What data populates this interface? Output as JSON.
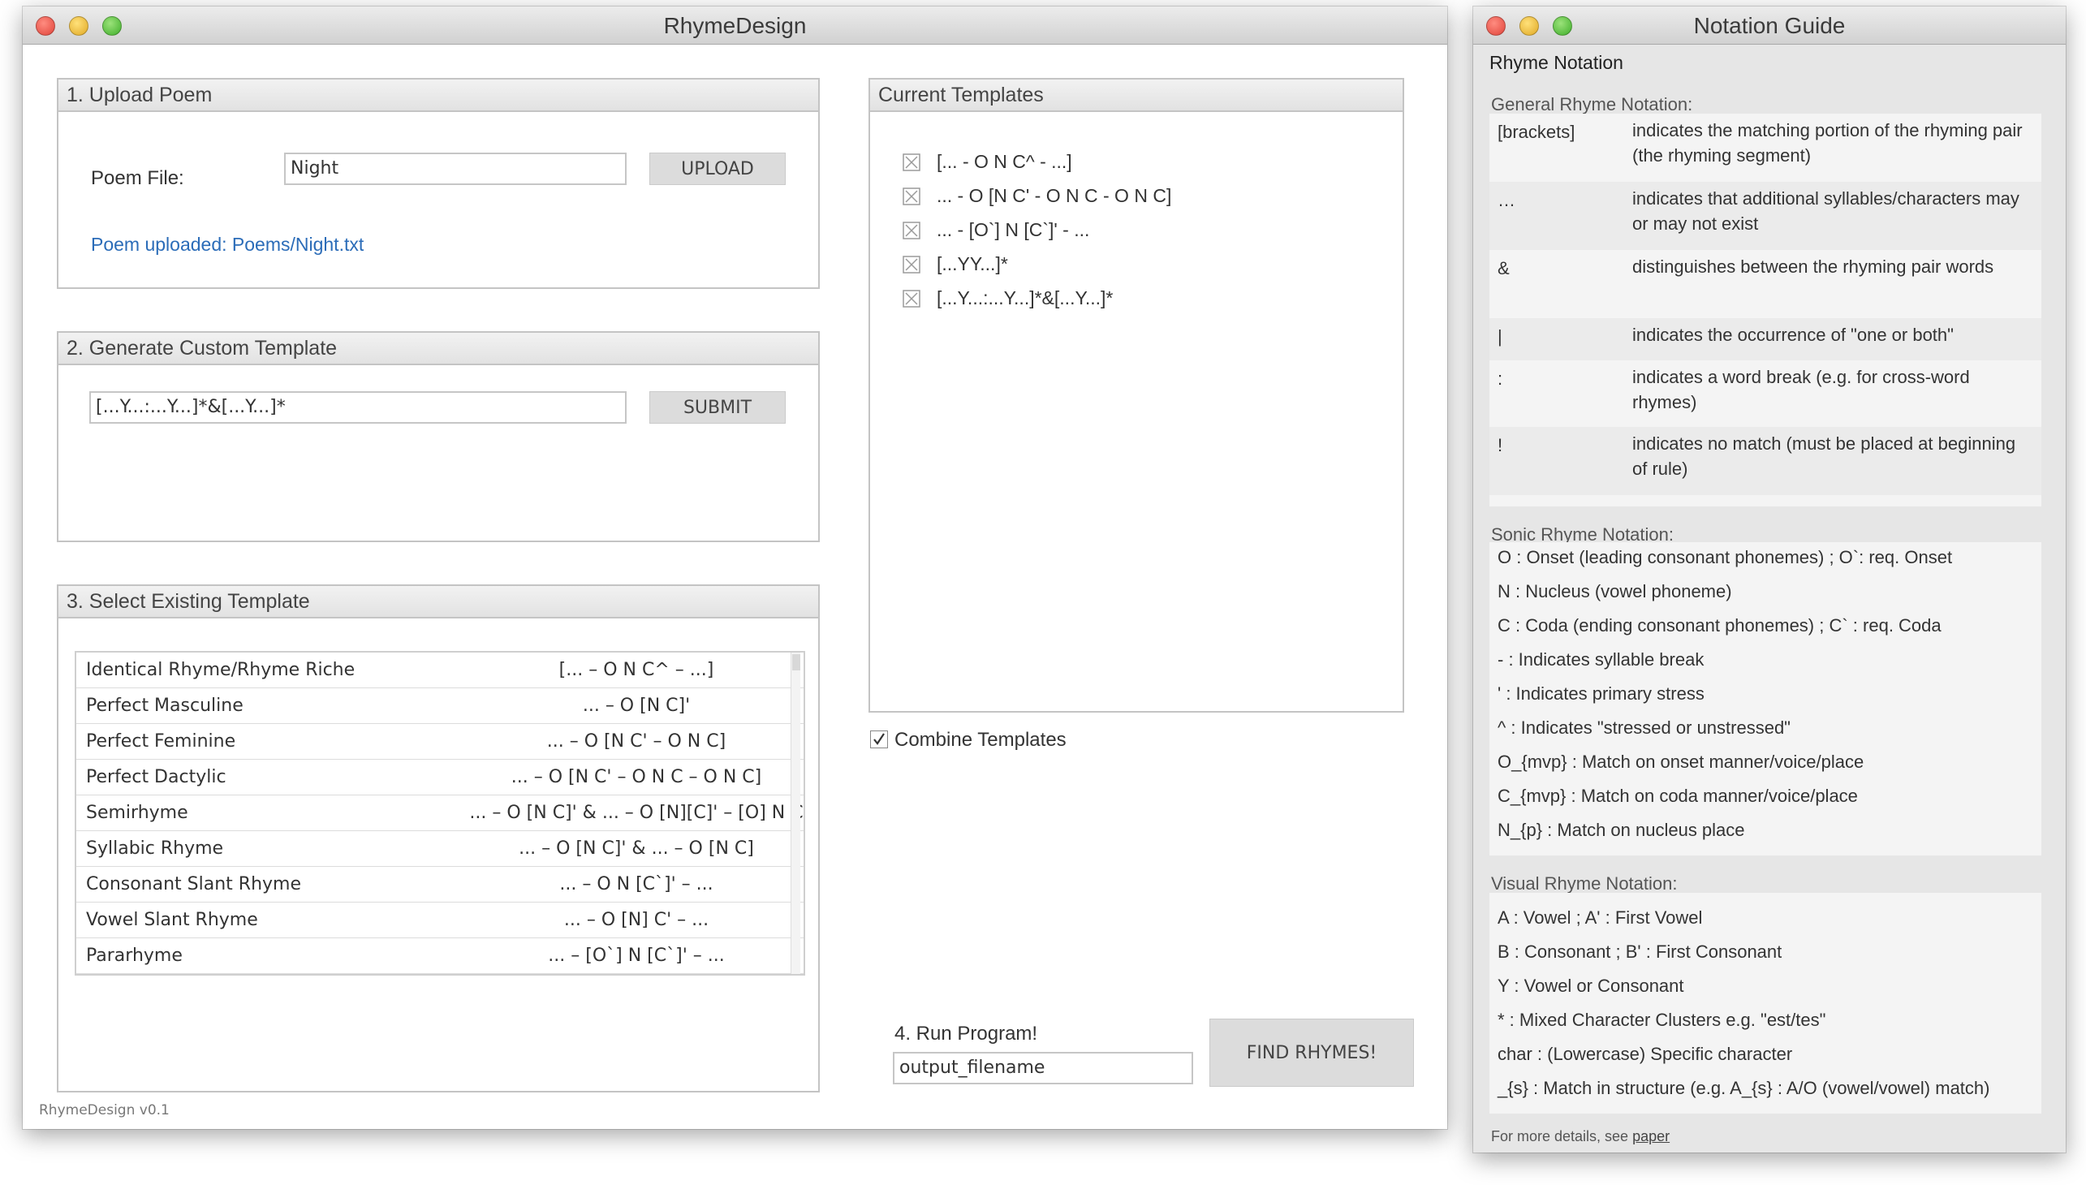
{
  "main_window": {
    "title": "RhymeDesign",
    "version": "RhymeDesign v0.1"
  },
  "upload": {
    "header": "1. Upload Poem",
    "label": "Poem File:",
    "value": "Night",
    "button": "UPLOAD",
    "status": "Poem uploaded: Poems/Night.txt"
  },
  "generate": {
    "header": "2. Generate Custom Template",
    "value": "[...Y...:...Y...]*&[...Y...]*",
    "button": "SUBMIT"
  },
  "select": {
    "header": "3. Select Existing Template",
    "rows": [
      {
        "name": "Identical Rhyme/Rhyme Riche",
        "pattern": "[... – O N C^ – ...]"
      },
      {
        "name": "Perfect Masculine",
        "pattern": "... – O [N C]'"
      },
      {
        "name": "Perfect Feminine",
        "pattern": "... – O [N C' – O N C]"
      },
      {
        "name": "Perfect Dactylic",
        "pattern": "... – O [N C' – O N C – O N C]"
      },
      {
        "name": "Semirhyme",
        "pattern": "... – O [N C]' & ... – O [N][C]' – [O] N C"
      },
      {
        "name": "Syllabic Rhyme",
        "pattern": "... – O [N C]' & ... – O [N C]"
      },
      {
        "name": "Consonant Slant Rhyme",
        "pattern": "... – O N [C`]' – ..."
      },
      {
        "name": "Vowel Slant Rhyme",
        "pattern": "... – O [N] C' – ..."
      },
      {
        "name": "Pararhyme",
        "pattern": "... – [O`] N [C`]' – ..."
      }
    ]
  },
  "current": {
    "header": "Current Templates",
    "items": [
      "[... - O N C^ - ...]",
      "... - O [N C' - O N C - O N C]",
      "... - [O`] N [C`]' - ...",
      "[...YY...]*",
      "[...Y...:...Y...]*&[...Y...]*"
    ],
    "combine_label": "Combine Templates",
    "combine_checked": true
  },
  "run": {
    "label": "4. Run Program!",
    "value": "output_filename",
    "button": "FIND RHYMES!"
  },
  "guide": {
    "title": "Notation Guide",
    "heading": "Rhyme Notation",
    "general_label": "General Rhyme Notation:",
    "general": [
      {
        "sym": "[brackets]",
        "desc": "indicates the matching portion of the rhyming pair (the rhyming segment)"
      },
      {
        "sym": "…",
        "desc": "indicates that additional syllables/characters may or may not exist"
      },
      {
        "sym": "&",
        "desc": "distinguishes between the rhyming pair words"
      },
      {
        "sym": "|",
        "desc": "indicates the occurrence of \"one or both\""
      },
      {
        "sym": ":",
        "desc": "indicates a word break (e.g. for cross-word rhymes)"
      },
      {
        "sym": "!",
        "desc": "indicates no match (must be placed at beginning of rule)"
      }
    ],
    "sonic_label": "Sonic Rhyme Notation:",
    "sonic": [
      "O :  Onset (leading consonant phonemes) ; O`: req. Onset",
      "N :  Nucleus (vowel phoneme)",
      "C : Coda (ending consonant phonemes) ; C` : req. Coda",
      " - : Indicates syllable break",
      "' :  Indicates primary stress",
      "^ :  Indicates \"stressed or unstressed\"",
      "O_{mvp} : Match on onset manner/voice/place",
      "C_{mvp} : Match on coda manner/voice/place",
      "N_{p} : Match on nucleus place"
    ],
    "visual_label": "Visual Rhyme Notation:",
    "visual": [
      "A :  Vowel ; A' : First Vowel",
      "B :  Consonant ; B' : First Consonant",
      "Y :  Vowel or Consonant",
      "* : Mixed Character Clusters e.g. \"est/tes\"",
      " char : (Lowercase) Specific character",
      "_{s} :  Match in structure (e.g. A_{s} : A/O (vowel/vowel) match)"
    ],
    "footer_prefix": "For more details, see ",
    "footer_link": "paper"
  }
}
